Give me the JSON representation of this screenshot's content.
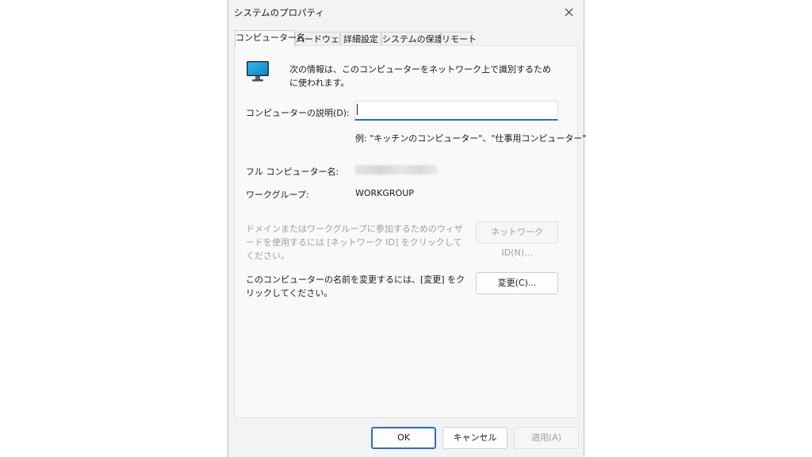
{
  "window": {
    "title": "システムのプロパティ"
  },
  "tabs": [
    {
      "label": "コンピューター名",
      "active": true
    },
    {
      "label": "ハードウェア",
      "active": false
    },
    {
      "label": "詳細設定",
      "active": false
    },
    {
      "label": "システムの保護",
      "active": false
    },
    {
      "label": "リモート",
      "active": false
    }
  ],
  "panel": {
    "icon": "monitor-icon",
    "info_text": "次の情報は、このコンピューターをネットワーク上で識別するために使われます。",
    "description_label": "コンピューターの説明(D):",
    "description_value": "",
    "example_text": "例: \"キッチンのコンピューター\"、\"仕事用コンピューター\"",
    "full_name_label": "フル コンピューター名:",
    "workgroup_label": "ワークグループ:",
    "workgroup_value": "WORKGROUP",
    "wizard_text": "ドメインまたはワークグループに参加するためのウィザードを使用するには [ネットワーク ID] をクリックしてください。",
    "network_id_button": "ネットワーク ID(N)...",
    "rename_text": "このコンピューターの名前を変更するには、[変更] をクリックしてください。",
    "change_button": "変更(C)..."
  },
  "footer": {
    "ok_label": "OK",
    "cancel_label": "キャンセル",
    "apply_label": "適用(A)"
  },
  "colors": {
    "accent": "#2b6fb8",
    "icon_blue": "#1aa3d9"
  }
}
